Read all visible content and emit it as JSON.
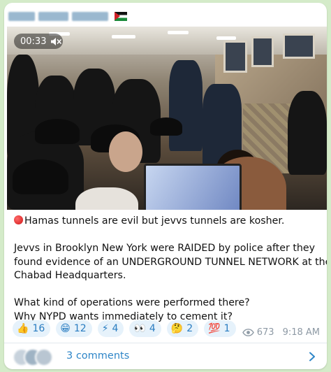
{
  "colors": {
    "background": "#d4ebc9",
    "bubble": "#ffffff",
    "link_blue": "#2f86c8",
    "reaction_bg": "#e6f2fb",
    "meta_gray": "#8e9aa5"
  },
  "video": {
    "timer": "00:33",
    "muted": true
  },
  "post": {
    "lines": [
      "Hamas tunnels are evil but jevvs tunnels are kosher.",
      "",
      "Jevvs in Brooklyn New York were RAIDED by police after they",
      "found evidence of an UNDERGROUND TUNNEL NETWORK at the",
      "Chabad Headquarters.",
      "",
      "What kind of operations were performed there?",
      "Why NYPD wants immediately to cement it?"
    ]
  },
  "reactions": [
    {
      "emoji": "👍",
      "count": "16"
    },
    {
      "emoji": "😁",
      "count": "12"
    },
    {
      "emoji": "⚡",
      "count": "4"
    },
    {
      "emoji": "👀",
      "count": "4"
    },
    {
      "emoji": "🤔",
      "count": "2"
    },
    {
      "emoji": "💯",
      "count": "1"
    }
  ],
  "meta": {
    "views": "673",
    "time": "9:18 AM"
  },
  "comments": {
    "label": "3 comments"
  },
  "icons": {
    "flag": "palestine-flag-icon",
    "mute": "speaker-muted-icon",
    "views": "eye-icon",
    "open": "chevron-right-icon"
  }
}
